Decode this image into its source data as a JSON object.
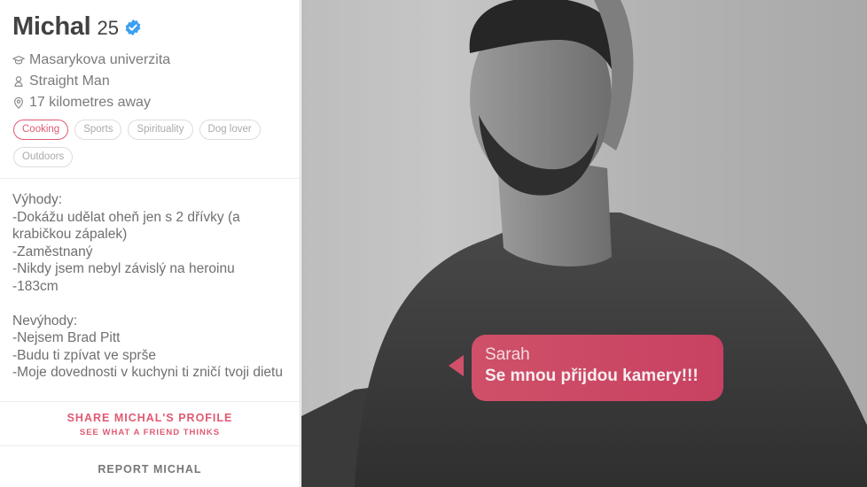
{
  "profile": {
    "name": "Michal",
    "age": "25",
    "verified": true,
    "school": "Masarykova univerzita",
    "orientation": "Straight Man",
    "distance": "17 kilometres away",
    "interests": [
      {
        "label": "Cooking",
        "active": true
      },
      {
        "label": "Sports",
        "active": false
      },
      {
        "label": "Spirituality",
        "active": false
      },
      {
        "label": "Dog lover",
        "active": false
      },
      {
        "label": "Outdoors",
        "active": false
      }
    ],
    "bio": "Výhody:\n-Dokážu udělat oheň jen s 2 dřívky (a krabičkou zápalek)\n-Zaměstnaný\n-Nikdy jsem nebyl závislý na heroinu\n-183cm\n\nNevýhody:\n-Nejsem Brad Pitt\n-Budu ti zpívat ve sprše\n-Moje dovednosti v kuchyni ti zničí tvoji dietu"
  },
  "actions": {
    "share_label": "SHARE MICHAL'S PROFILE",
    "share_sub": "SEE WHAT A FRIEND THINKS",
    "report_label": "REPORT MICHAL"
  },
  "chat_bubble": {
    "sender": "Sarah",
    "message": "Se mnou přijdou kamery!!!"
  },
  "colors": {
    "accent": "#e05a73",
    "verified": "#3d9ff2",
    "bubble": "#cc4866"
  },
  "icons": {
    "school": "graduation-cap-icon",
    "orientation": "person-icon",
    "distance": "location-pin-icon",
    "verified": "verified-badge-icon"
  }
}
